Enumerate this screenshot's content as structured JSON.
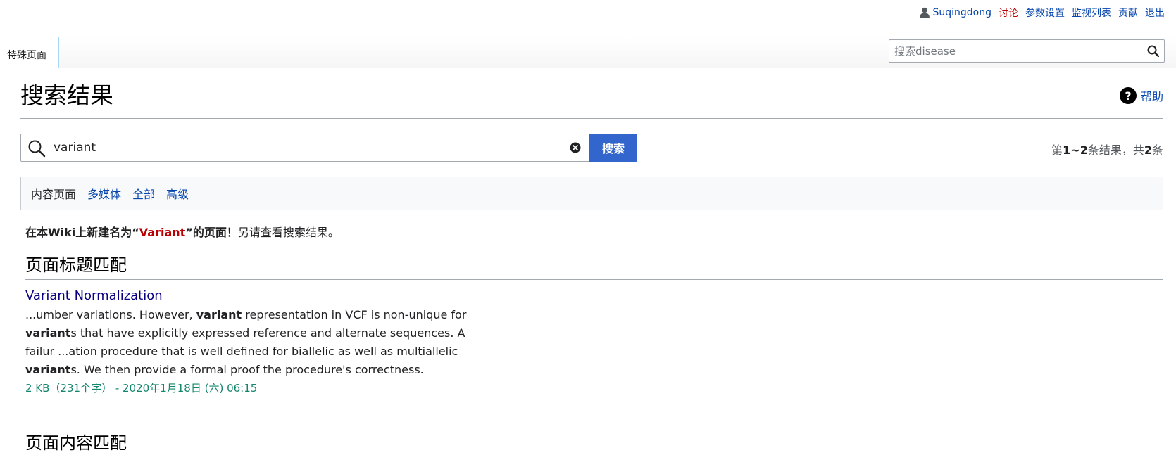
{
  "personal": {
    "username": "Suqingdong",
    "talk": "讨论",
    "preferences": "参数设置",
    "watchlist": "监视列表",
    "contributions": "贡献",
    "logout": "退出"
  },
  "tabs": {
    "special": "特殊页面"
  },
  "top_search": {
    "placeholder": "搜索disease"
  },
  "heading": "搜索结果",
  "help_label": "帮助",
  "search": {
    "value": "variant",
    "button": "搜索"
  },
  "result_count": {
    "prefix": "第",
    "range": "1~2",
    "middle": "条结果，共",
    "total": "2",
    "suffix": "条"
  },
  "profiles": {
    "current": "内容页面",
    "items": [
      "多媒体",
      "全部",
      "高级"
    ]
  },
  "create": {
    "bold_prefix": "在本Wiki上新建名为“",
    "page_name": "Variant",
    "bold_suffix": "”的页面！",
    "rest": "另请查看搜索结果。"
  },
  "sections": {
    "title_matches": "页面标题匹配",
    "content_matches": "页面内容匹配"
  },
  "results": [
    {
      "title": "Variant Normalization",
      "snippet": [
        {
          "t": "...umber variations. However, "
        },
        {
          "b": "variant"
        },
        {
          "t": " representation in VCF is non-unique for "
        },
        {
          "b": "variant"
        },
        {
          "t": "s that have explicitly expressed reference and alternate sequences. A failur ...ation procedure that is well defined for biallelic as well as multiallelic "
        },
        {
          "b": "variant"
        },
        {
          "t": "s. We then provide a formal proof the procedure's correctness."
        }
      ],
      "meta": "2 KB（231个字） - 2020年1月18日 (六) 06:15"
    }
  ],
  "colors": {
    "link": "#0645ad",
    "visited": "#0b0080",
    "new_link": "#ba0000",
    "primary_button": "#3366cc",
    "meta_green": "#14866d"
  }
}
